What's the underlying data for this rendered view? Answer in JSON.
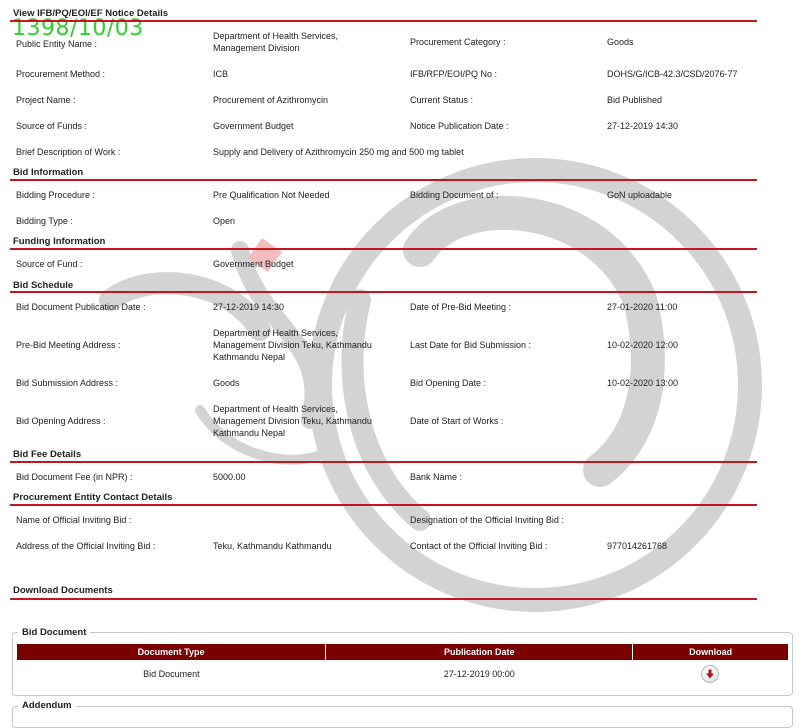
{
  "stamp": "1398/10/03",
  "notice": {
    "title": "View IFB/PQ/EOI/EF Notice Details",
    "public_entity_label": "Public Entity Name :",
    "public_entity_value": "Department of Health Services, Management Division",
    "procurement_category_label": "Procurement Category :",
    "procurement_category_value": "Goods",
    "procurement_method_label": "Procurement Method :",
    "procurement_method_value": "ICB",
    "ifb_no_label": "IFB/RFP/EOI/PQ No :",
    "ifb_no_value": "DOHS/G/ICB-42.3/CSD/2076-77",
    "project_name_label": "Project Name :",
    "project_name_value": "Procurement of Azithromycin",
    "current_status_label": "Current Status :",
    "current_status_value": "Bid Published",
    "source_funds_label": "Source of Funds :",
    "source_funds_value": "Government Budget",
    "notice_pub_date_label": "Notice Publication Date :",
    "notice_pub_date_value": "27-12-2019 14:30",
    "brief_desc_label": "Brief Description of Work :",
    "brief_desc_value": "Supply and Delivery of Azithromycin 250 mg and 500 mg tablet"
  },
  "bid_info": {
    "title": "Bid Information",
    "procedure_label": "Bidding Procedure :",
    "procedure_value": "Pre Qualification Not Needed",
    "document_of_label": "Bidding Document of :",
    "document_of_value": "GoN uploadable",
    "type_label": "Bidding Type :",
    "type_value": "Open"
  },
  "funding": {
    "title": "Funding Information",
    "source_label": "Source of Fund :",
    "source_value": "Government Budget"
  },
  "schedule": {
    "title": "Bid Schedule",
    "doc_pub_date_label": "Bid Document Publication Date :",
    "doc_pub_date_value": "27-12-2019 14:30",
    "pre_bid_date_label": "Date of Pre-Bid Meeting :",
    "pre_bid_date_value": "27-01-2020 11:00",
    "pre_bid_addr_label": "Pre-Bid Meeting Address :",
    "pre_bid_addr_value": "Department of Health Services, Management Division Teku, Kathmandu Kathmandu Nepal",
    "last_date_label": "Last Date for Bid Submission :",
    "last_date_value": "10-02-2020 12:00",
    "submission_addr_label": "Bid Submission Address :",
    "submission_addr_value": "Goods",
    "opening_date_label": "Bid Opening Date :",
    "opening_date_value": "10-02-2020 13:00",
    "opening_addr_label": "Bid Opening Address :",
    "opening_addr_value": "Department of Health Services, Management Division Teku, Kathmandu Kathmandu Nepal",
    "start_works_label": "Date of Start of Works :",
    "start_works_value": ""
  },
  "fee": {
    "title": "Bid Fee Details",
    "fee_label": "Bid Document Fee (in NPR) :",
    "fee_value": "5000.00",
    "bank_label": "Bank Name :",
    "bank_value": ""
  },
  "contact": {
    "title": "Procurement Entity Contact Details",
    "official_name_label": "Name of Official Inviting Bid :",
    "official_name_value": "",
    "designation_label": "Designation of the Official Inviting Bid :",
    "designation_value": "",
    "address_label": "Address of the Official Inviting Bid :",
    "address_value": "Teku, Kathmandu Kathmandu",
    "contact_label": "Contact of the Official Inviting Bid :",
    "contact_value": "977014261768"
  },
  "downloads": {
    "title": "Download Documents",
    "bid_document_legend": "Bid Document",
    "columns": [
      "Document Type",
      "Publication Date",
      "Download"
    ],
    "rows": [
      {
        "type": "Bid Document",
        "date": "27-12-2019 00:00",
        "icon": "download-arrow-icon"
      }
    ],
    "addendum_legend": "Addendum"
  },
  "colors": {
    "rule": "#c4161c",
    "table_header": "#7a0000",
    "stamp": "#2fcf2f"
  }
}
